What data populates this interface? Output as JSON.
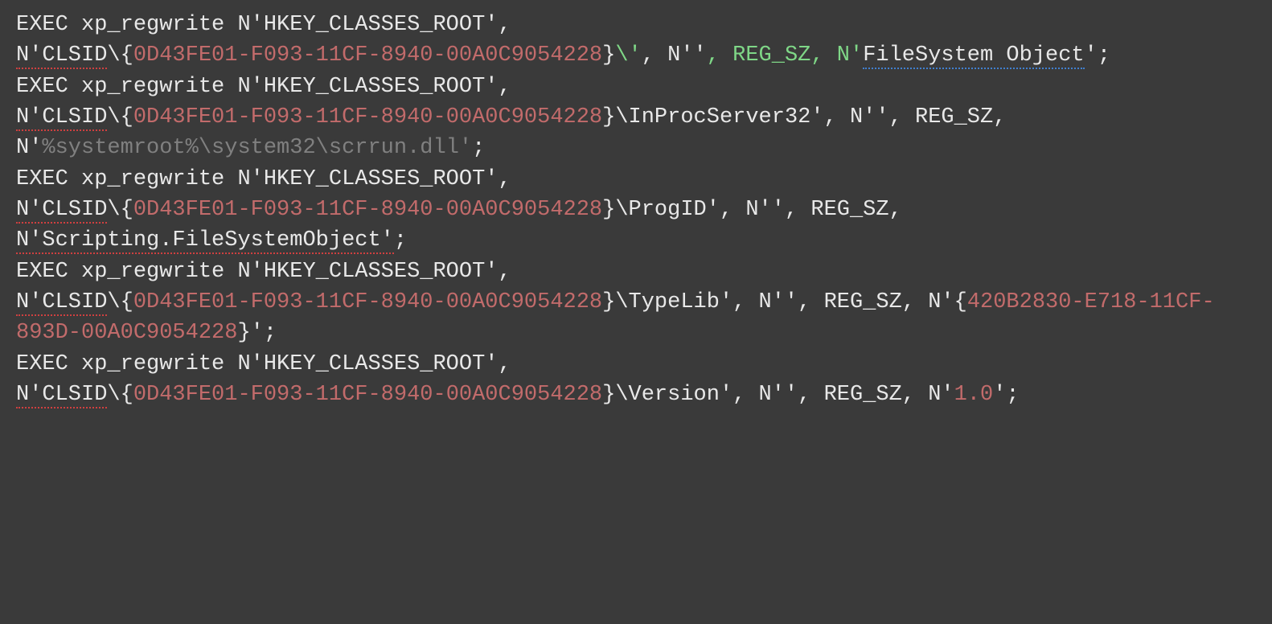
{
  "code": {
    "stmt1": {
      "exec": "EXEC xp_regwrite N'HKEY_CLASSES_ROOT',",
      "clsid_prefix": "N'CLSID",
      "brace_open": "\\{",
      "guid": "0D43FE01-F093-11CF-8940-00A0C9054228",
      "brace_close": "}",
      "close_esc": "\\'",
      "comma_n_empty": ", N''",
      "comma_reg": ", REG_SZ",
      "comma_n_start": ", N'",
      "value": "FileSystem Object",
      "end": "';"
    },
    "stmt2": {
      "exec": "EXEC xp_regwrite N'HKEY_CLASSES_ROOT',",
      "clsid_prefix": "N'CLSID",
      "brace_open": "\\{",
      "guid": "0D43FE01-F093-11CF-8940-00A0C9054228",
      "after_guid": "}\\InProcServer32', N'', REG_SZ, N'",
      "value": "%systemroot%\\system32\\scrrun.dll'",
      "end": ";"
    },
    "stmt3": {
      "exec": "EXEC xp_regwrite N'HKEY_CLASSES_ROOT',",
      "clsid_prefix": "N'CLSID",
      "brace_open": "\\{",
      "guid": "0D43FE01-F093-11CF-8940-00A0C9054228",
      "after_guid": "}\\ProgID', N'', REG_SZ, ",
      "value": "N'Scripting.FileSystemObject'",
      "end": ";"
    },
    "stmt4": {
      "exec": "EXEC xp_regwrite N'HKEY_CLASSES_ROOT',",
      "clsid_prefix": "N'CLSID",
      "brace_open": "\\{",
      "guid": "0D43FE01-F093-11CF-8940-00A0C9054228",
      "after_guid": "}\\TypeLib', N'', REG_SZ, N'{",
      "value": "420B2830-E718-11CF-893D-00A0C9054228",
      "value_close": "}'",
      "end": ";"
    },
    "stmt5": {
      "exec": "EXEC xp_regwrite N'HKEY_CLASSES_ROOT',",
      "clsid_prefix": "N'CLSID",
      "brace_open": "\\{",
      "guid": "0D43FE01-F093-11CF-8940-00A0C9054228",
      "after_guid": "}\\Version', N'', REG_SZ, N'",
      "value": "1.0",
      "value_close": "'",
      "end": ";"
    }
  }
}
